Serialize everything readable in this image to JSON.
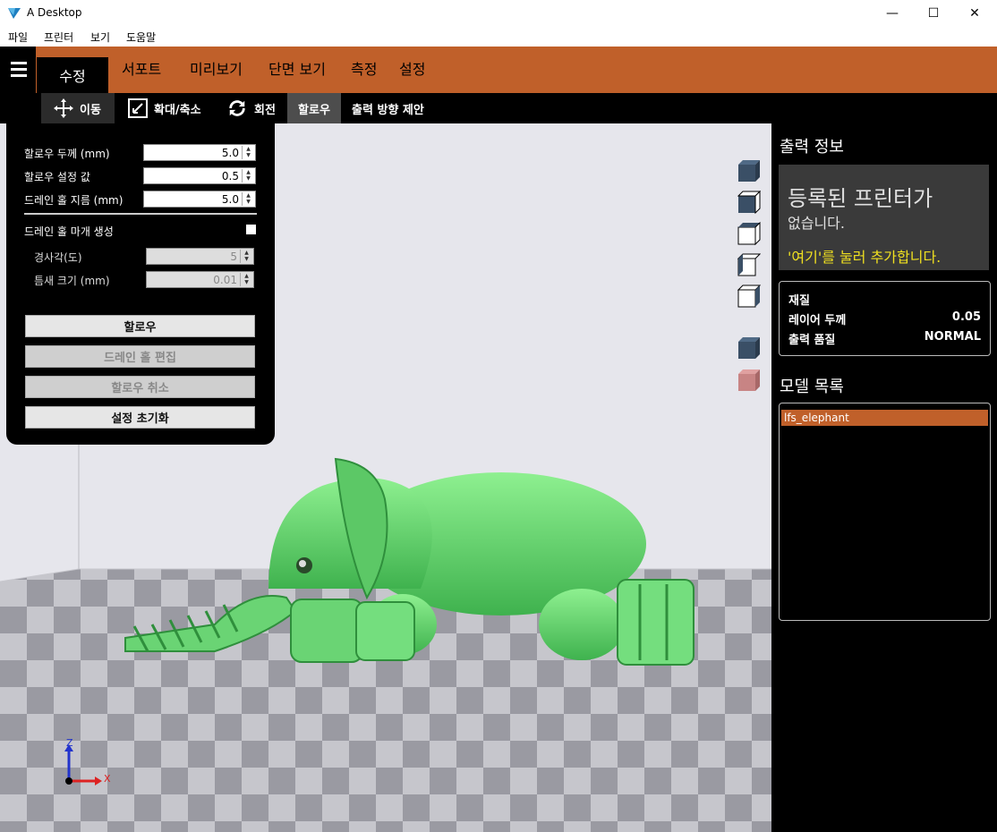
{
  "window": {
    "title": "A Desktop",
    "minimize": "—",
    "maximize": "☐",
    "close": "✕"
  },
  "menu": [
    "파일",
    "프린터",
    "보기",
    "도움말"
  ],
  "tabs": {
    "active": "수정",
    "items": [
      "서포트",
      "미리보기",
      "단면 보기",
      "측정",
      "설정"
    ]
  },
  "subtools": {
    "move": "이동",
    "scale": "확대/축소",
    "rotate": "회전",
    "hollow": "할로우",
    "orient": "출력 방향 제안"
  },
  "hollow_panel": {
    "thickness_label": "할로우 두께 (mm)",
    "thickness_value": "5.0",
    "setting_label": "할로우 설정 값",
    "setting_value": "0.5",
    "drain_diameter_label": "드레인 홀 지름 (mm)",
    "drain_diameter_value": "5.0",
    "drain_cap_label": "드레인 홀 마개 생성",
    "slope_label": "경사각(도)",
    "slope_value": "5",
    "gap_label": "틈새 크기 (mm)",
    "gap_value": "0.01",
    "btn_hollow": "할로우",
    "btn_edit_drain": "드레인 홀 편집",
    "btn_undo_hollow": "할로우 취소",
    "btn_reset": "설정 초기화"
  },
  "right_panel": {
    "print_info_title": "출력 정보",
    "no_printer_line1": "등록된 프린터가",
    "no_printer_line2": "없습니다.",
    "add_printer_hint": "'여기'를 눌러 추가합니다.",
    "material_label": "재질",
    "layer_label": "레이어 두께",
    "layer_value": "0.05",
    "quality_label": "출력 품질",
    "quality_value": "NORMAL",
    "model_list_title": "모델 목록",
    "models": [
      "lfs_elephant"
    ]
  },
  "axes": {
    "z": "Z",
    "x": "X"
  },
  "colors": {
    "accent": "#c0602a",
    "model": "#6ddb78",
    "hint": "#f0e020"
  }
}
